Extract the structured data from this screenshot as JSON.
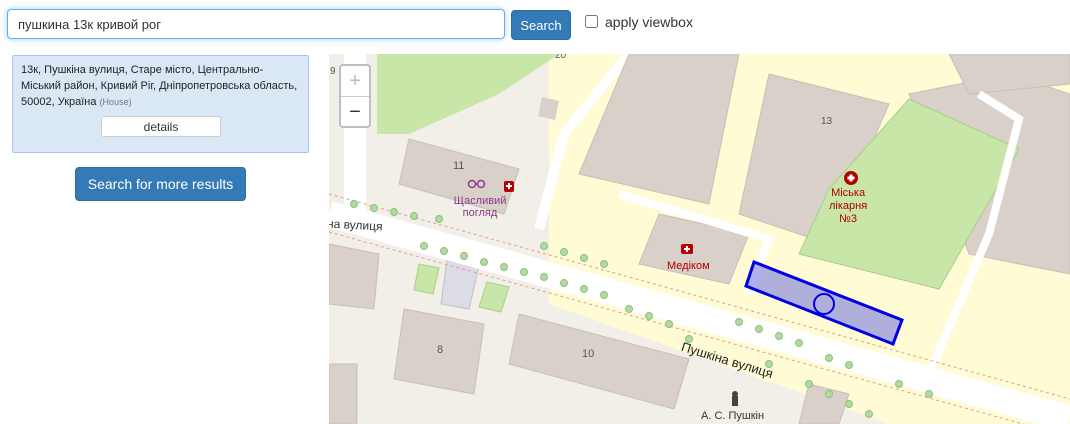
{
  "search": {
    "value": "пушкина 13к кривой рог",
    "button_label": "Search",
    "viewbox_label": "apply viewbox"
  },
  "result": {
    "address": "13к, Пушкіна вулиця, Старе місто, Центрально-Міський район, Кривий Ріг, Дніпропетровська область, 50002, Україна",
    "type": "(House)",
    "details_label": "details"
  },
  "more_results_label": "Search for more results",
  "map": {
    "zoom_in": "+",
    "zoom_out": "−",
    "street_left": "на вулиця",
    "street_right": "Пушкіна вулиця",
    "poi_optician": "Щасливий погляд",
    "poi_medikom": "Медіком",
    "poi_hospital_line1": "Міська",
    "poi_hospital_line2": "лікарня",
    "poi_hospital_line3": "№3",
    "monument": "А. С. Пушкін",
    "building_11": "11",
    "building_8": "8",
    "building_10": "10",
    "building_13": "13",
    "building_20": "20",
    "building_9": "9"
  },
  "colors": {
    "highlight_fill": "#7b7be0",
    "highlight_stroke": "#0000e6",
    "hospital_grounds": "#fffbd5",
    "grass": "#c8e6a8",
    "building": "#d9d0c9",
    "accent": "#337ab7"
  }
}
